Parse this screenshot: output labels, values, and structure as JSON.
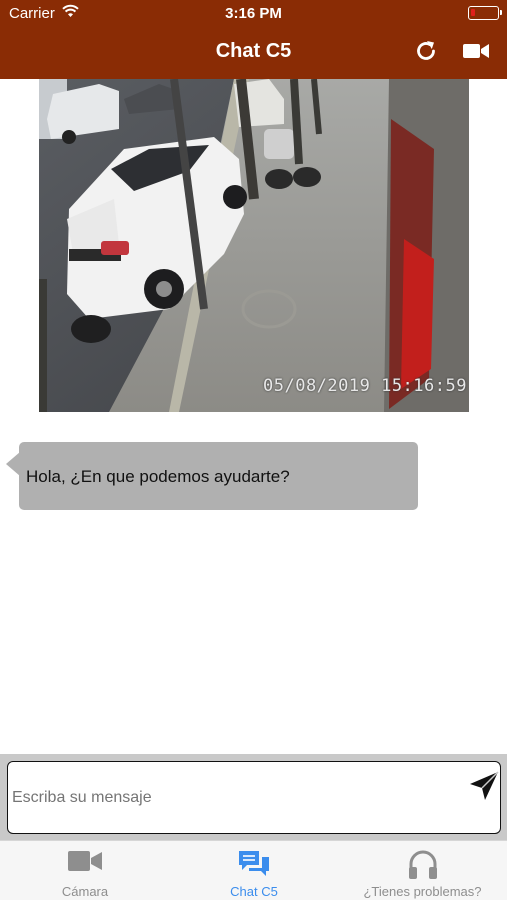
{
  "status_bar": {
    "carrier": "Carrier",
    "time": "3:16 PM",
    "battery_color": "#e0201b"
  },
  "header": {
    "title": "Chat C5",
    "background": "#8a2c05",
    "icons": [
      "refresh-icon",
      "video-camera-icon"
    ]
  },
  "camera_feed": {
    "timestamp": "05/08/2019 15:16:59"
  },
  "chat": {
    "messages": [
      {
        "text": "Hola, ¿En que podemos ayudarte?"
      }
    ]
  },
  "composer": {
    "placeholder": "Escriba su mensaje",
    "value": "",
    "send_icon": "send-icon"
  },
  "tabs": [
    {
      "label": "Cámara",
      "icon": "video-camera-icon",
      "active": false
    },
    {
      "label": "Chat C5",
      "icon": "chat-bubbles-icon",
      "active": true
    },
    {
      "label": "¿Tienes problemas?",
      "icon": "headphones-icon",
      "active": false
    }
  ],
  "colors": {
    "active_tab": "#3b8ded",
    "inactive_tab": "#8e8e8e",
    "bubble": "#b0b0b0"
  }
}
